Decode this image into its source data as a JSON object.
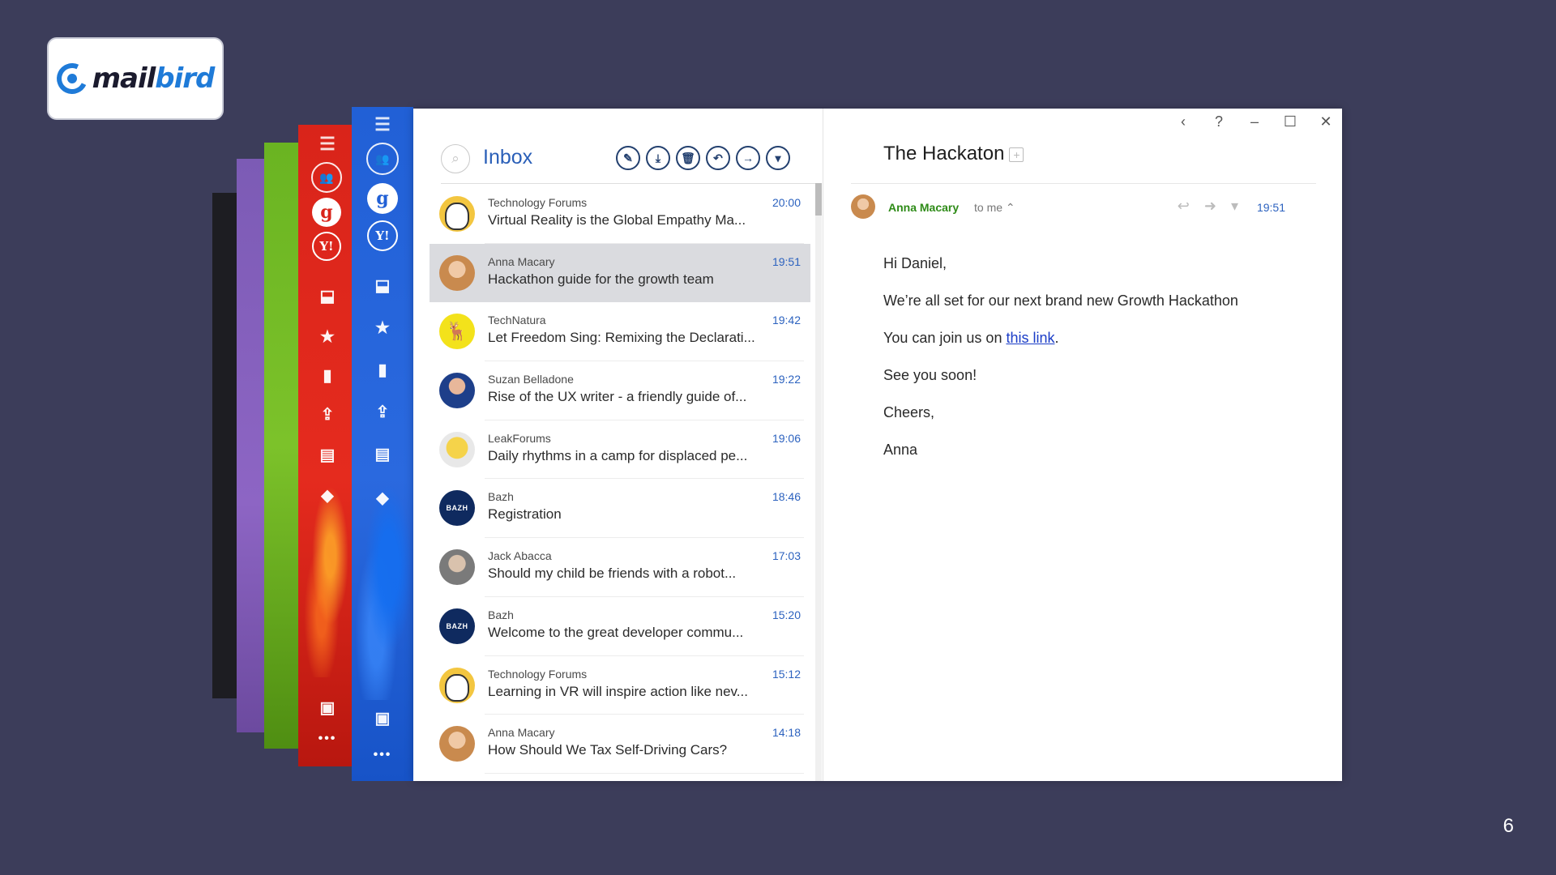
{
  "logo": {
    "mail": "mail",
    "bird": "bird"
  },
  "page_number": "6",
  "window_controls": [
    "‹",
    "?",
    "–",
    "☐",
    "✕"
  ],
  "list": {
    "title": "Inbox",
    "search_icon": "search-icon",
    "toolbar": [
      "compose-icon",
      "download-icon",
      "trash-icon",
      "reply-icon",
      "forward-icon",
      "more-icon"
    ],
    "items": [
      {
        "sender": "Technology Forums",
        "subject": "Virtual Reality is the Global Empathy Ma...",
        "time": "20:00",
        "avatar": "av-tech"
      },
      {
        "sender": "Anna Macary",
        "subject": "Hackathon guide for the growth team",
        "time": "19:51",
        "avatar": "av-anna",
        "selected": true
      },
      {
        "sender": "TechNatura",
        "subject": "Let Freedom Sing: Remixing the Declarati...",
        "time": "19:42",
        "avatar": "av-natura"
      },
      {
        "sender": "Suzan Belladone",
        "subject": "Rise of the UX writer - a friendly guide of...",
        "time": "19:22",
        "avatar": "av-suzan"
      },
      {
        "sender": "LeakForums",
        "subject": "Daily rhythms in a camp for displaced pe...",
        "time": "19:06",
        "avatar": "av-leak"
      },
      {
        "sender": "Bazh",
        "subject": "Registration",
        "time": "18:46",
        "avatar": "av-bazh",
        "avatar_text": "BAZH"
      },
      {
        "sender": "Jack Abacca",
        "subject": "Should my child be friends with a robot...",
        "time": "17:03",
        "avatar": "av-jack"
      },
      {
        "sender": "Bazh",
        "subject": "Welcome to the great developer commu...",
        "time": "15:20",
        "avatar": "av-bazh",
        "avatar_text": "BAZH"
      },
      {
        "sender": "Technology Forums",
        "subject": "Learning in VR will inspire action like nev...",
        "time": "15:12",
        "avatar": "av-tech"
      },
      {
        "sender": "Anna Macary",
        "subject": "How Should We Tax Self-Driving Cars?",
        "time": "14:18",
        "avatar": "av-anna"
      }
    ]
  },
  "reader": {
    "title": "The Hackaton",
    "from_name": "Anna Macary",
    "to_me": "to me ⌃",
    "time": "19:51",
    "greeting": "Hi Daniel,",
    "line1": "We’re all set for our next brand new Growth Hackathon",
    "line2_prefix": "You can join us on ",
    "line2_link": "this link",
    "line2_suffix": ".",
    "line3": "See you soon!",
    "line4": "Cheers,",
    "line5": "Anna"
  },
  "colors": {
    "background": "#3c3d5a",
    "accent_blue": "#2160d6",
    "accent_red": "#d9241a",
    "accent_green": "#6ab422",
    "accent_purple": "#7c5bb5",
    "time_blue": "#2c62bf",
    "sender_green": "#2e8b17"
  }
}
